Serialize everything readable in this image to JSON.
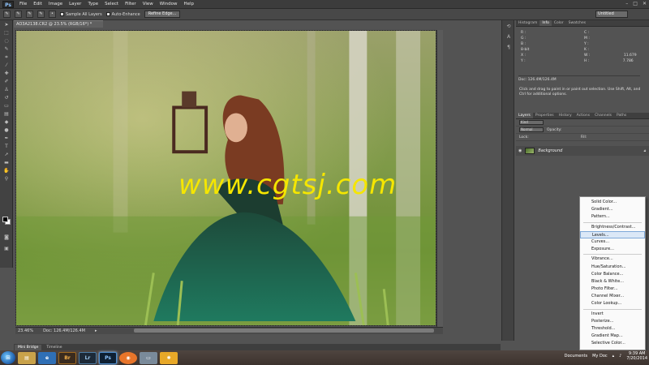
{
  "app": {
    "logo": "Ps"
  },
  "menu": [
    "File",
    "Edit",
    "Image",
    "Layer",
    "Type",
    "Select",
    "Filter",
    "View",
    "Window",
    "Help"
  ],
  "window_controls": [
    "–",
    "□",
    "✕"
  ],
  "options": {
    "sample_all_layers": "Sample All Layers",
    "auto_enhance": "Auto-Enhance",
    "refine_edge": "Refine Edge...",
    "workspace": "Untitled"
  },
  "document": {
    "tab_title": "AO3A2138.CR2 @ 23.5% (RGB/16*) *",
    "zoom": "23.46%",
    "doc_size": "Doc: 126.4M/126.4M",
    "watermark": "www.cgtsj.com"
  },
  "panels": {
    "top_tabs": [
      "Histogram",
      "Info",
      "Color",
      "Swatches"
    ],
    "info": {
      "r": "R :",
      "g": "G :",
      "b": "B :",
      "bit": "8-bit",
      "c": "C :",
      "m": "M :",
      "y": "Y :",
      "k": "K :",
      "x": "X :",
      "yy": "Y :",
      "w": "W :",
      "h": "H :",
      "w_val": "11.679",
      "h_val": "7.786",
      "doc": "Doc: 126.4M/126.4M"
    },
    "hint": "Click and drag to paint in or paint out selection. Use Shift, Alt, and Ctrl for additional options.",
    "layer_tabs": [
      "Layers",
      "Properties",
      "History",
      "Actions",
      "Channels",
      "Paths"
    ],
    "layers": {
      "kind": "Kind",
      "blend": "Normal",
      "opacity_label": "Opacity:",
      "lock_label": "Lock:",
      "fill_label": "Fill:",
      "background": "Background"
    }
  },
  "adjust_menu": {
    "group1": [
      "Solid Color...",
      "Gradient...",
      "Pattern..."
    ],
    "group2": [
      "Brightness/Contrast...",
      "Levels...",
      "Curves...",
      "Exposure..."
    ],
    "group3": [
      "Vibrance...",
      "Hue/Saturation...",
      "Color Balance...",
      "Black & White...",
      "Photo Filter...",
      "Channel Mixer...",
      "Color Lookup..."
    ],
    "group4": [
      "Invert",
      "Posterize...",
      "Threshold...",
      "Gradient Map...",
      "Selective Color..."
    ],
    "highlighted": "Levels..."
  },
  "minibridge": [
    "Mini Bridge",
    "Timeline"
  ],
  "taskbar": {
    "apps": [
      "Br",
      "Lr",
      "Ps"
    ],
    "documents": "Documents",
    "mydoc": "My Doc",
    "time": "9:39 AM",
    "date": "7/20/2014"
  },
  "colors": {
    "brand_ps": "#8fc6ff",
    "watermark": "#f5e600",
    "highlight": "#dbe8f7"
  }
}
